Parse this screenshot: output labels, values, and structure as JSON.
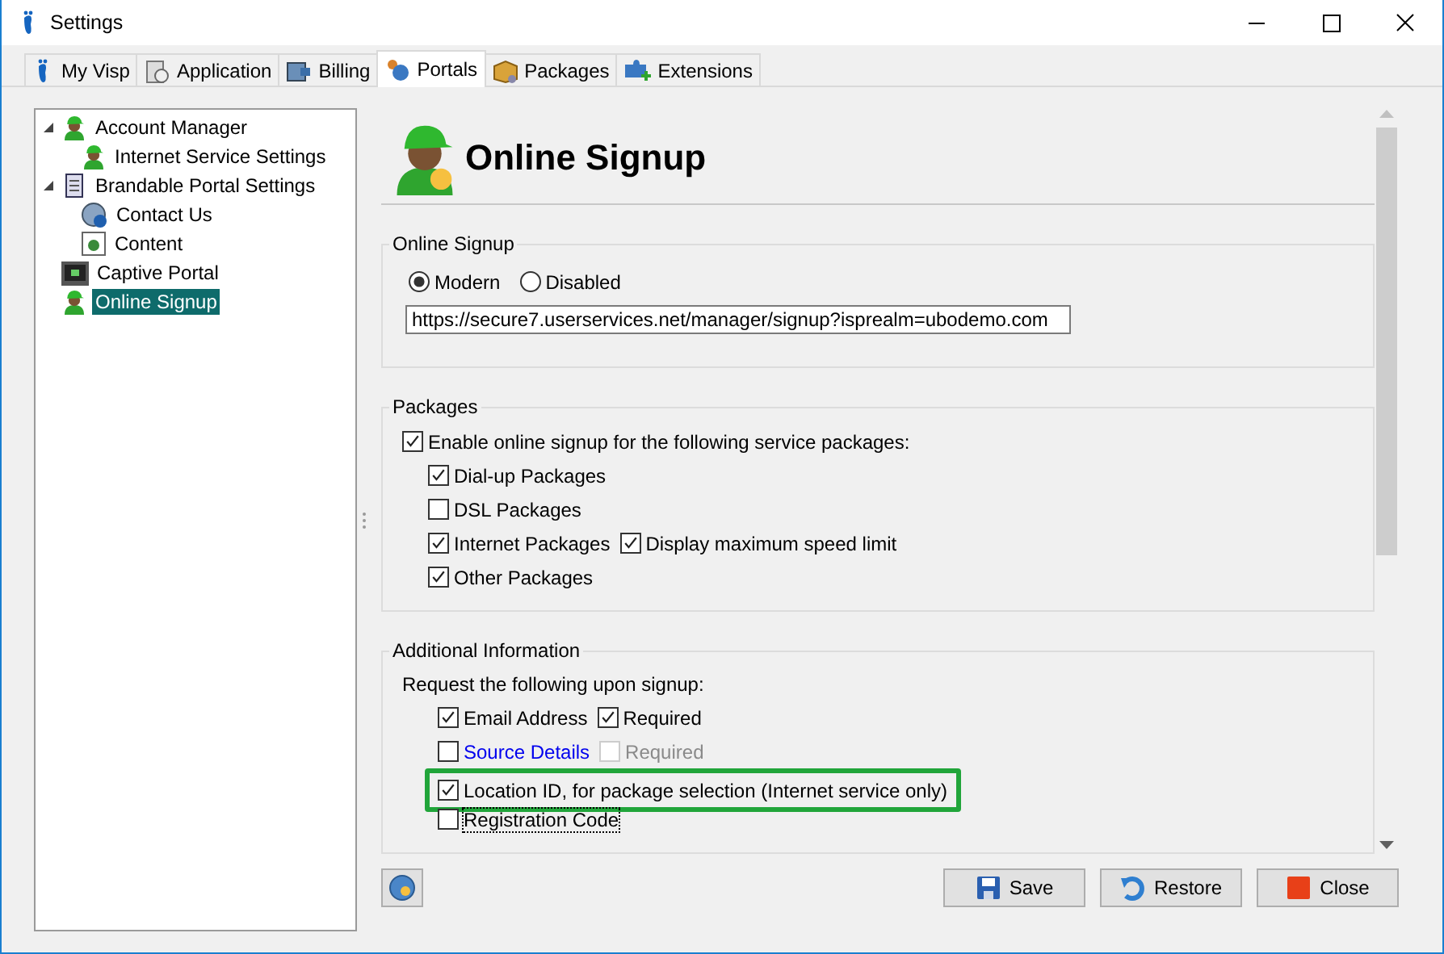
{
  "window": {
    "title": "Settings"
  },
  "tabs": [
    {
      "label": "My Visp",
      "selected": false
    },
    {
      "label": "Application",
      "selected": false
    },
    {
      "label": "Billing",
      "selected": false
    },
    {
      "label": "Portals",
      "selected": true
    },
    {
      "label": "Packages",
      "selected": false
    },
    {
      "label": "Extensions",
      "selected": false
    }
  ],
  "tree": [
    {
      "label": "Account Manager",
      "expanded": true,
      "selected": false,
      "children": [
        {
          "label": "Internet Service Settings",
          "selected": false
        }
      ]
    },
    {
      "label": "Brandable Portal Settings",
      "expanded": true,
      "selected": false,
      "children": [
        {
          "label": "Contact Us",
          "selected": false
        },
        {
          "label": "Content",
          "selected": false
        }
      ]
    },
    {
      "label": "Captive Portal",
      "selected": false
    },
    {
      "label": "Online Signup",
      "selected": true
    }
  ],
  "page": {
    "title": "Online Signup"
  },
  "sections": [
    {
      "title": "Online Signup",
      "options": [
        {
          "label": "Modern",
          "selected": true
        },
        {
          "label": "Disabled",
          "selected": false
        }
      ],
      "url": "https://secure7.userservices.net/manager/signup?isprealm=ubodemo.com"
    },
    {
      "title": "Packages",
      "master": {
        "label": "Enable online signup for the following service packages:",
        "checked": true
      },
      "rows": [
        {
          "items": [
            {
              "label": "Dial-up Packages",
              "checked": true,
              "kind": "checkbox",
              "disabled": false,
              "focused": false
            }
          ]
        },
        {
          "items": [
            {
              "label": "DSL Packages",
              "checked": false,
              "kind": "checkbox",
              "disabled": false,
              "focused": false
            }
          ]
        },
        {
          "items": [
            {
              "label": "Internet Packages",
              "checked": true,
              "kind": "checkbox",
              "disabled": false,
              "focused": false
            },
            {
              "label": "Display maximum speed limit",
              "checked": true,
              "kind": "checkbox",
              "disabled": false,
              "focused": false
            }
          ]
        },
        {
          "items": [
            {
              "label": "Other Packages",
              "checked": true,
              "kind": "checkbox",
              "disabled": false,
              "focused": false
            }
          ]
        }
      ]
    },
    {
      "title": "Additional Information",
      "intro": "Request the following upon signup:",
      "rows": [
        {
          "highlighted": false,
          "items": [
            {
              "label": "Email Address",
              "checked": true,
              "kind": "checkbox",
              "disabled": false,
              "focused": false
            },
            {
              "label": "Required",
              "checked": true,
              "kind": "checkbox",
              "disabled": false,
              "focused": false
            }
          ]
        },
        {
          "highlighted": false,
          "items": [
            {
              "label": "Source Details",
              "checked": false,
              "kind": "link",
              "disabled": false,
              "focused": false
            },
            {
              "label": "Required",
              "checked": false,
              "kind": "checkbox",
              "disabled": true,
              "focused": false
            }
          ]
        },
        {
          "highlighted": true,
          "items": [
            {
              "label": "Location ID, for package selection (Internet service only)",
              "checked": true,
              "kind": "checkbox",
              "disabled": false,
              "focused": false
            }
          ]
        },
        {
          "highlighted": false,
          "items": [
            {
              "label": "Registration Code",
              "checked": false,
              "kind": "checkbox",
              "disabled": false,
              "focused": true
            }
          ]
        }
      ]
    }
  ],
  "buttons": [
    {
      "label": "Save"
    },
    {
      "label": "Restore"
    },
    {
      "label": "Close"
    }
  ]
}
